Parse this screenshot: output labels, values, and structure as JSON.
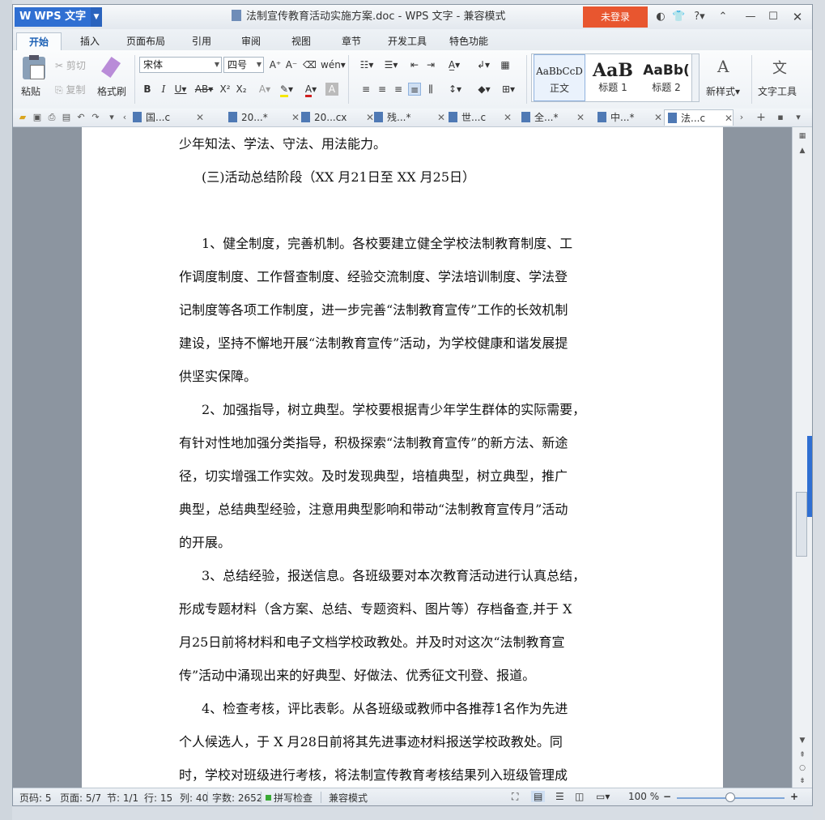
{
  "app": {
    "name": "WPS 文字",
    "title": "法制宣传教育活动实施方案.doc - WPS 文字 - 兼容模式",
    "login_label": "未登录"
  },
  "ribbon_tabs": [
    "开始",
    "插入",
    "页面布局",
    "引用",
    "审阅",
    "视图",
    "章节",
    "开发工具",
    "特色功能"
  ],
  "ribbon": {
    "paste": "粘贴",
    "cut": "剪切",
    "copy": "复制",
    "format_painter": "格式刷",
    "font": "宋体",
    "size": "四号",
    "styles": [
      {
        "preview": "AaBbCcD",
        "label": "正文"
      },
      {
        "preview": "AaB",
        "label": "标题 1"
      },
      {
        "preview": "AaBb(",
        "label": "标题 2"
      }
    ],
    "new_style": "新样式",
    "text_tools": "文字工具"
  },
  "doc_tabs": [
    "国...c",
    "20...*",
    "20...cx",
    "残...*",
    "世...c",
    "全...*",
    "中...*",
    "法...c"
  ],
  "document": {
    "paragraphs": [
      {
        "indent": false,
        "lines": [
          "少年知法、学法、守法、用法能力。"
        ]
      },
      {
        "indent": true,
        "lines": [
          "(三)活动总结阶段（XX 月21日至 XX 月25日）"
        ]
      },
      {
        "indent": true,
        "lines": [
          "1、健全制度，完善机制。各校要建立健全学校法制教育制度、工",
          "作调度制度、工作督查制度、经验交流制度、学法培训制度、学法登",
          "记制度等各项工作制度，进一步完善“法制教育宣传”工作的长效机制",
          "建设，坚持不懈地开展“法制教育宣传”活动，为学校健康和谐发展提",
          "供坚实保障。"
        ]
      },
      {
        "indent": true,
        "lines": [
          "2、加强指导，树立典型。学校要根据青少年学生群体的实际需要，",
          "有针对性地加强分类指导，积极探索“法制教育宣传”的新方法、新途",
          "径，切实增强工作实效。及时发现典型，培植典型，树立典型，推广",
          "典型，总结典型经验，注意用典型影响和带动“法制教育宣传月”活动",
          "的开展。"
        ]
      },
      {
        "indent": true,
        "lines": [
          "3、总结经验，报送信息。各班级要对本次教育活动进行认真总结，",
          "形成专题材料（含方案、总结、专题资料、图片等）存档备查,并于 X",
          "月25日前将材料和电子文档学校政教处。并及时对这次“法制教育宣",
          "传”活动中涌现出来的好典型、好做法、优秀征文刊登、报道。"
        ]
      },
      {
        "indent": true,
        "lines": [
          "4、检查考核，评比表彰。从各班级或教师中各推荐1名作为先进",
          "个人候选人，于 X 月28日前将其先进事迹材料报送学校政教处。同",
          "时，学校对班级进行考核，将法制宣传教育考核结果列入班级管理成"
        ]
      }
    ]
  },
  "status": {
    "page_num": "页码: 5",
    "pages": "页面: 5/7",
    "section": "节: 1/1",
    "row": "行: 15",
    "col": "列: 40",
    "words": "字数: 2652",
    "spell": "拼写检查",
    "mode": "兼容模式",
    "zoom": "100 %",
    "zoom_level": 100
  },
  "colors": {
    "accent": "#2f6fd2",
    "login": "#e8562f"
  }
}
